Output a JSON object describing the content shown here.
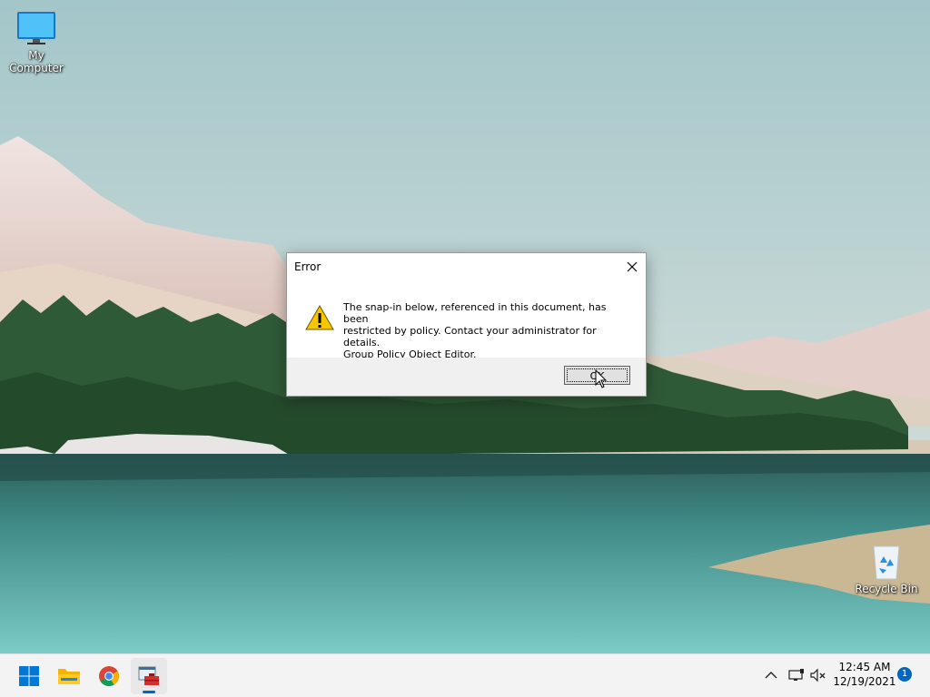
{
  "desktop": {
    "icons": [
      {
        "label": "My Computer",
        "icon": "monitor-icon"
      },
      {
        "label": "Recycle Bin",
        "icon": "recycle-bin-icon"
      }
    ]
  },
  "dialog": {
    "title": "Error",
    "close_icon": "close-icon",
    "message_lines": [
      "The snap-in below, referenced in this document, has been",
      "restricted by policy. Contact your administrator for details.",
      "Group Policy Object Editor."
    ],
    "icon": "warning-icon",
    "ok_label": "OK"
  },
  "taskbar": {
    "apps": [
      {
        "name": "Start",
        "icon": "windows-start-icon",
        "active": false
      },
      {
        "name": "File Explorer",
        "icon": "folder-icon",
        "active": false
      },
      {
        "name": "Google Chrome",
        "icon": "chrome-icon",
        "active": false
      },
      {
        "name": "Microsoft Management Console",
        "icon": "toolbox-icon",
        "active": true
      }
    ],
    "tray": {
      "icons": [
        "chevron-up-icon",
        "network-icon",
        "speaker-muted-icon"
      ],
      "time": "12:45 AM",
      "date": "12/19/2021",
      "notification_count": "1"
    }
  },
  "colors": {
    "accent": "#0067c0",
    "taskbar_bg": "#f3f3f3",
    "dialog_footer": "#f0f0f0"
  }
}
